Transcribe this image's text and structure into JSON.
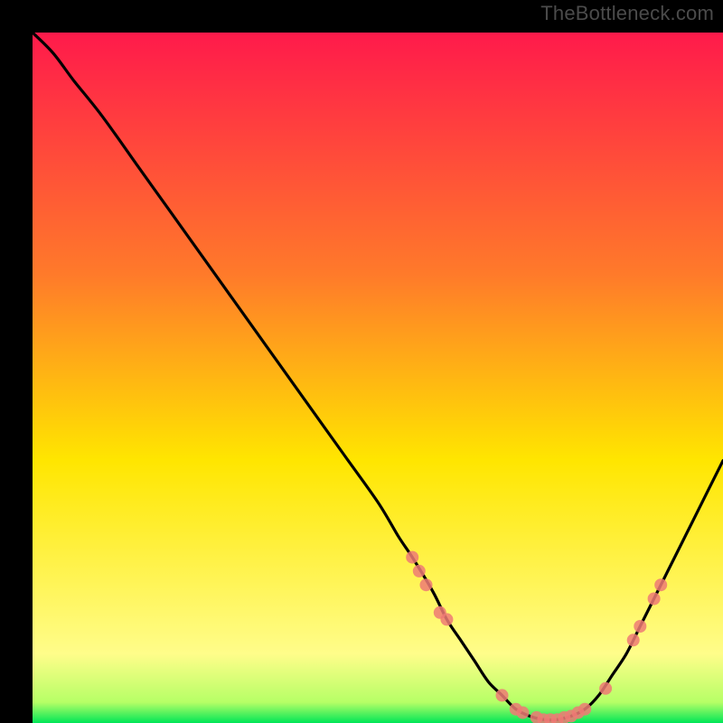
{
  "watermark": "TheBottleneck.com",
  "colors": {
    "bg": "#000000",
    "grad_top": "#ff1a4b",
    "grad_mid1": "#ff7a2a",
    "grad_mid2": "#ffe600",
    "grad_low": "#fffd8a",
    "grad_green": "#00e657",
    "curve": "#000000",
    "marker_fill": "#ef7a74",
    "marker_stroke": "#ef7a74"
  },
  "chart_data": {
    "type": "line",
    "title": "",
    "xlabel": "",
    "ylabel": "",
    "xlim": [
      0,
      100
    ],
    "ylim": [
      0,
      100
    ],
    "series": [
      {
        "name": "bottleneck-curve",
        "x": [
          0,
          3,
          6,
          10,
          15,
          20,
          25,
          30,
          35,
          40,
          45,
          50,
          53,
          55,
          58,
          60,
          62,
          64,
          66,
          68,
          70,
          72,
          74,
          76,
          78,
          80,
          82,
          84,
          86,
          88,
          90,
          92,
          95,
          98,
          100
        ],
        "y": [
          100,
          97,
          93,
          88,
          81,
          74,
          67,
          60,
          53,
          46,
          39,
          32,
          27,
          24,
          19,
          15,
          12,
          9,
          6,
          4,
          2,
          1,
          0.5,
          0.5,
          1,
          2,
          4,
          7,
          10,
          14,
          18,
          22,
          28,
          34,
          38
        ]
      }
    ],
    "markers": [
      {
        "x": 55,
        "y": 24
      },
      {
        "x": 56,
        "y": 22
      },
      {
        "x": 57,
        "y": 20
      },
      {
        "x": 59,
        "y": 16
      },
      {
        "x": 60,
        "y": 15
      },
      {
        "x": 68,
        "y": 4
      },
      {
        "x": 70,
        "y": 2
      },
      {
        "x": 71,
        "y": 1.5
      },
      {
        "x": 73,
        "y": 0.8
      },
      {
        "x": 74,
        "y": 0.5
      },
      {
        "x": 75,
        "y": 0.5
      },
      {
        "x": 76,
        "y": 0.5
      },
      {
        "x": 77,
        "y": 0.8
      },
      {
        "x": 78,
        "y": 1
      },
      {
        "x": 79,
        "y": 1.5
      },
      {
        "x": 80,
        "y": 2
      },
      {
        "x": 83,
        "y": 5
      },
      {
        "x": 87,
        "y": 12
      },
      {
        "x": 88,
        "y": 14
      },
      {
        "x": 90,
        "y": 18
      },
      {
        "x": 91,
        "y": 20
      }
    ]
  }
}
